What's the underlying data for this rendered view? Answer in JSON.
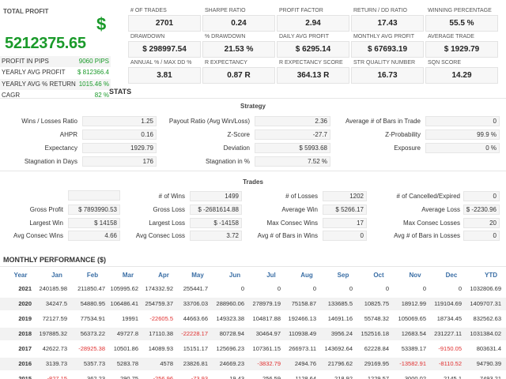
{
  "summary": {
    "total_profit_label": "TOTAL PROFIT",
    "currency_symbol": "$",
    "total_profit_value": "5212375.65",
    "rows": [
      {
        "label": "PROFIT IN PIPS",
        "value": "9060 PIPS"
      },
      {
        "label": "YEARLY AVG PROFIT",
        "value": "$ 812366.4"
      },
      {
        "label": "YEARLY AVG % RETURN",
        "value": "1015.46 %"
      },
      {
        "label": "CAGR",
        "value": "82 %"
      }
    ]
  },
  "cards": [
    {
      "title": "# OF TRADES",
      "value": "2701"
    },
    {
      "title": "SHARPE RATIO",
      "value": "0.24"
    },
    {
      "title": "PROFIT FACTOR",
      "value": "2.94"
    },
    {
      "title": "RETURN / DD RATIO",
      "value": "17.43"
    },
    {
      "title": "WINNING PERCENTAGE",
      "value": "55.5 %"
    },
    {
      "title": "DRAWDOWN",
      "value": "$ 298997.54"
    },
    {
      "title": "% DRAWDOWN",
      "value": "21.53 %"
    },
    {
      "title": "DAILY AVG PROFIT",
      "value": "$ 6295.14"
    },
    {
      "title": "MONTHLY AVG PROFIT",
      "value": "$ 67693.19"
    },
    {
      "title": "AVERAGE TRADE",
      "value": "$ 1929.79"
    },
    {
      "title": "ANNUAL % / MAX DD %",
      "value": "3.81"
    },
    {
      "title": "R EXPECTANCY",
      "value": "0.87 R"
    },
    {
      "title": "R EXPECTANCY SCORE",
      "value": "364.13 R"
    },
    {
      "title": "STR QUALITY NUMBER",
      "value": "16.73"
    },
    {
      "title": "SQN SCORE",
      "value": "14.29"
    }
  ],
  "stats": {
    "title": "STATS",
    "strategy_title": "Strategy",
    "strategy": [
      {
        "label": "Wins / Losses Ratio",
        "value": "1.25"
      },
      {
        "label": "AHPR",
        "value": "0.16"
      },
      {
        "label": "Expectancy",
        "value": "1929.79"
      },
      {
        "label": "Stagnation in Days",
        "value": "176"
      },
      {
        "label": "Payout Ratio (Avg Win/Loss)",
        "value": "2.36"
      },
      {
        "label": "Z-Score",
        "value": "-27.7"
      },
      {
        "label": "Deviation",
        "value": "$ 5993.68"
      },
      {
        "label": "Stagnation in %",
        "value": "7.52 %"
      },
      {
        "label": "Average # of Bars in Trade",
        "value": "0"
      },
      {
        "label": "Z-Probability",
        "value": "99.9 %"
      },
      {
        "label": "Exposure",
        "value": "0 %"
      }
    ],
    "trades_title": "Trades",
    "trades": [
      {
        "label": "",
        "value": ""
      },
      {
        "label": "Gross Profit",
        "value": "$ 7893990.53"
      },
      {
        "label": "Largest Win",
        "value": "$ 14158"
      },
      {
        "label": "Avg Consec Wins",
        "value": "4.66"
      },
      {
        "label": "# of Wins",
        "value": "1499"
      },
      {
        "label": "Gross Loss",
        "value": "$ -2681614.88"
      },
      {
        "label": "Largest Loss",
        "value": "$ -14158"
      },
      {
        "label": "Avg Consec Loss",
        "value": "3.72"
      },
      {
        "label": "# of Losses",
        "value": "1202"
      },
      {
        "label": "Average Win",
        "value": "$ 5266.17"
      },
      {
        "label": "Max Consec Wins",
        "value": "17"
      },
      {
        "label": "Avg # of Bars in Wins",
        "value": "0"
      },
      {
        "label": "# of Cancelled/Expired",
        "value": "0"
      },
      {
        "label": "Average Loss",
        "value": "$ -2230.96"
      },
      {
        "label": "Max Consec Losses",
        "value": "20"
      },
      {
        "label": "Avg # of Bars in Losses",
        "value": "0"
      }
    ]
  },
  "monthly": {
    "title": "MONTHLY PERFORMANCE ($)",
    "headers": [
      "Year",
      "Jan",
      "Feb",
      "Mar",
      "Apr",
      "May",
      "Jun",
      "Jul",
      "Aug",
      "Sep",
      "Oct",
      "Nov",
      "Dec",
      "YTD"
    ],
    "rows": [
      [
        "2021",
        "240185.98",
        "211850.47",
        "105995.62",
        "174332.92",
        "255441.7",
        "0",
        "0",
        "0",
        "0",
        "0",
        "0",
        "0",
        "1032806.69"
      ],
      [
        "2020",
        "34247.5",
        "54880.95",
        "106486.41",
        "254759.37",
        "33706.03",
        "288960.06",
        "278979.19",
        "75158.87",
        "133685.5",
        "10825.75",
        "18912.99",
        "119104.69",
        "1409707.31"
      ],
      [
        "2019",
        "72127.59",
        "77534.91",
        "19991",
        "-22605.5",
        "44663.66",
        "149323.38",
        "104817.88",
        "192466.13",
        "14691.16",
        "55748.32",
        "105069.65",
        "18734.45",
        "832562.63"
      ],
      [
        "2018",
        "197885.32",
        "56373.22",
        "49727.8",
        "17110.38",
        "-22228.17",
        "80728.94",
        "30464.97",
        "110938.49",
        "3956.24",
        "152516.18",
        "12683.54",
        "231227.11",
        "1031384.02"
      ],
      [
        "2017",
        "42622.73",
        "-28925.38",
        "10501.86",
        "14089.93",
        "15151.17",
        "125696.23",
        "107361.15",
        "266973.11",
        "143692.64",
        "62228.84",
        "53389.17",
        "-9150.05",
        "803631.4"
      ],
      [
        "2016",
        "3139.73",
        "5357.73",
        "5283.78",
        "4578",
        "23826.81",
        "24669.23",
        "-3832.79",
        "2494.76",
        "21796.62",
        "29169.95",
        "-13582.91",
        "-8110.52",
        "94790.39"
      ],
      [
        "2015",
        "-827.15",
        "362.23",
        "290.75",
        "-256.96",
        "-73.93",
        "19.43",
        "256.59",
        "1128.64",
        "218.92",
        "1229.57",
        "3000.02",
        "2145.1",
        "7493.21"
      ]
    ]
  }
}
